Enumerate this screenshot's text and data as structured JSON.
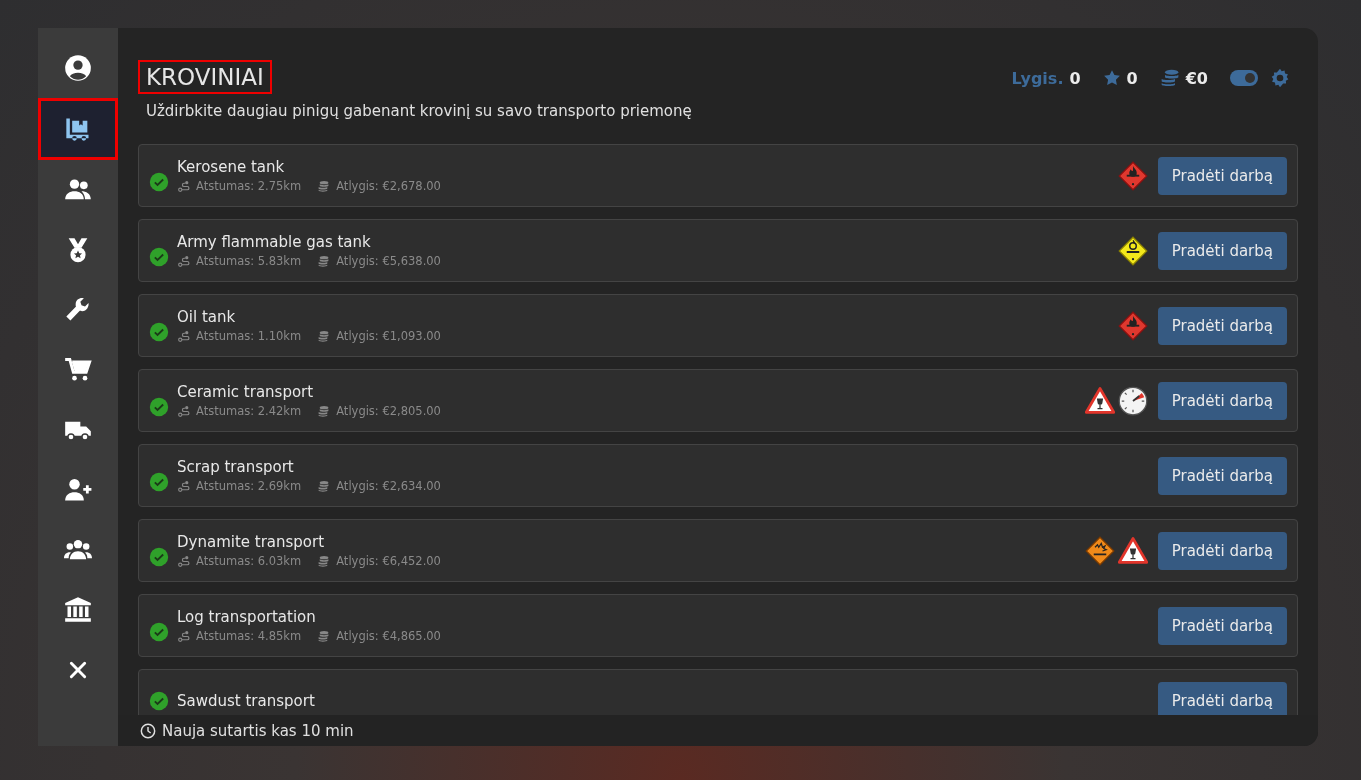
{
  "sidebar": {
    "items": [
      {
        "kind": "user-circle",
        "selected": false
      },
      {
        "kind": "cargo",
        "selected": true
      },
      {
        "kind": "users",
        "selected": false
      },
      {
        "kind": "medal",
        "selected": false
      },
      {
        "kind": "wrench",
        "selected": false
      },
      {
        "kind": "cart",
        "selected": false
      },
      {
        "kind": "truck",
        "selected": false
      },
      {
        "kind": "user-plus",
        "selected": false
      },
      {
        "kind": "group",
        "selected": false
      },
      {
        "kind": "bank",
        "selected": false
      },
      {
        "kind": "close",
        "selected": false
      }
    ]
  },
  "header": {
    "title": "KROVINIAI",
    "subtitle": "Uždirbkite daugiau pinigų gabenant krovinį su savo transporto priemonę",
    "level_label": "Lygis.",
    "level_value": "0",
    "stars_value": "0",
    "money_value": "€0",
    "toggle": {
      "on": true
    }
  },
  "jobs": [
    {
      "name": "Kerosene tank",
      "distance": "Atstumas: 2.75km",
      "reward": "Atlygis: €2,678.00",
      "hazards": [
        {
          "kind": "flammable-liquid"
        }
      ],
      "button": "Pradėti darbą"
    },
    {
      "name": "Army flammable gas tank",
      "distance": "Atstumas: 5.83km",
      "reward": "Atlygis: €5,638.00",
      "hazards": [
        {
          "kind": "oxidizer"
        }
      ],
      "button": "Pradėti darbą"
    },
    {
      "name": "Oil tank",
      "distance": "Atstumas: 1.10km",
      "reward": "Atlygis: €1,093.00",
      "hazards": [
        {
          "kind": "flammable-liquid"
        }
      ],
      "button": "Pradėti darbą"
    },
    {
      "name": "Ceramic transport",
      "distance": "Atstumas: 2.42km",
      "reward": "Atlygis: €2,805.00",
      "hazards": [
        {
          "kind": "fragile"
        },
        {
          "kind": "gauge"
        }
      ],
      "button": "Pradėti darbą"
    },
    {
      "name": "Scrap transport",
      "distance": "Atstumas: 2.69km",
      "reward": "Atlygis: €2,634.00",
      "button": "Pradėti darbą"
    },
    {
      "name": "Dynamite transport",
      "distance": "Atstumas: 6.03km",
      "reward": "Atlygis: €6,452.00",
      "hazards": [
        {
          "kind": "explosive"
        },
        {
          "kind": "fragile"
        }
      ],
      "button": "Pradėti darbą"
    },
    {
      "name": "Log transportation",
      "distance": "Atstumas: 4.85km",
      "reward": "Atlygis: €4,865.00",
      "button": "Pradėti darbą"
    },
    {
      "name": "Sawdust transport",
      "button": "Pradėti darbą"
    }
  ],
  "footer": {
    "text": "Nauja sutartis kas 10 min"
  }
}
